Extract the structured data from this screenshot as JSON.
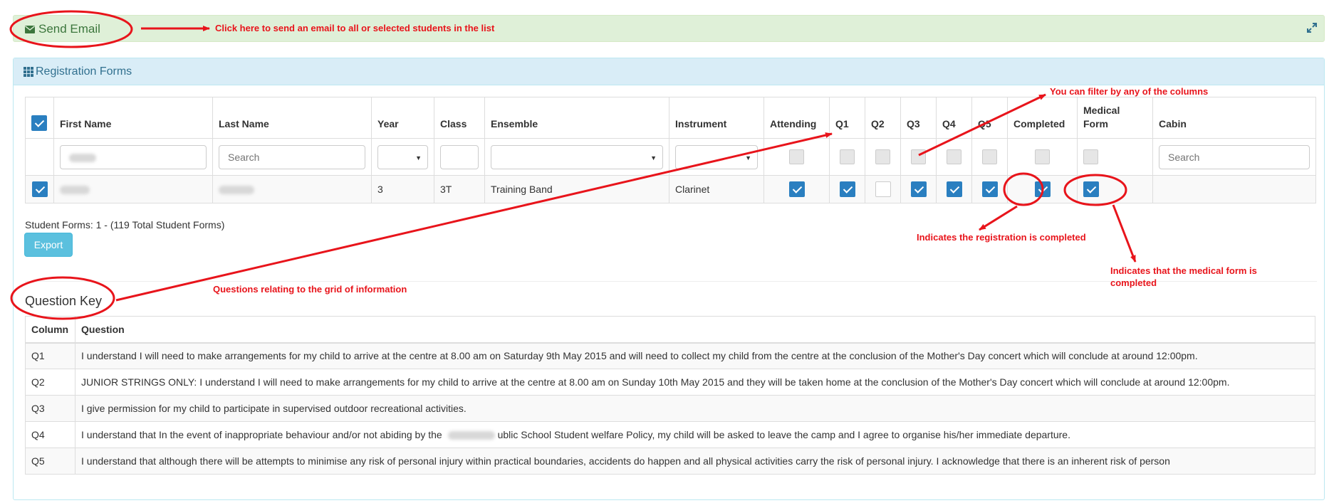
{
  "email_bar": {
    "send_email_label": "Send Email",
    "mail_icon": "envelope-icon",
    "expand_icon": "expand-icon"
  },
  "panel": {
    "title": "Registration Forms",
    "title_icon": "grid-icon"
  },
  "table": {
    "headers": [
      "First Name",
      "Last Name",
      "Year",
      "Class",
      "Ensemble",
      "Instrument",
      "Attending",
      "Q1",
      "Q2",
      "Q3",
      "Q4",
      "Q5",
      "Completed",
      "Medical Form",
      "Cabin"
    ],
    "filters": {
      "last_name_placeholder": "Search",
      "cabin_placeholder": "Search"
    },
    "rows": [
      {
        "selected": true,
        "year": "3",
        "class": "3T",
        "ensemble": "Training Band",
        "instrument": "Clarinet",
        "attending": true,
        "q1": true,
        "q2": false,
        "q3": true,
        "q4": true,
        "q5": true,
        "completed": true,
        "medical_form": true,
        "cabin": ""
      }
    ]
  },
  "footer": {
    "forms_count": "Student Forms: 1 - (119 Total Student Forms)",
    "export_label": "Export"
  },
  "question_key": {
    "title": "Question Key",
    "col_header": "Column",
    "question_header": "Question",
    "rows": [
      {
        "column": "Q1",
        "question": "I understand I will need to make arrangements for my child to arrive at the centre at 8.00 am on Saturday 9th May 2015 and will need to collect my child from the centre at the conclusion of the Mother's Day concert which will conclude at around 12:00pm."
      },
      {
        "column": "Q2",
        "question": "JUNIOR STRINGS ONLY: I understand I will need to make arrangements for my child to arrive at the centre at 8.00 am on Sunday 10th May 2015 and they will be taken home at the conclusion of the Mother's Day concert which will conclude at around 12:00pm."
      },
      {
        "column": "Q3",
        "question": "I give permission for my child to participate in supervised outdoor recreational activities."
      },
      {
        "column": "Q4",
        "question_before": "I understand that In the event of inappropriate behaviour and/or not abiding by the",
        "question_after": "ublic School Student welfare Policy, my child will be asked to leave the camp and I agree to organise his/her immediate departure."
      },
      {
        "column": "Q5",
        "question": "I understand that although there will be attempts to minimise any risk of personal injury within practical boundaries, accidents do happen and all physical activities carry the risk of personal injury. I acknowledge that there is an inherent risk of person"
      }
    ]
  },
  "annotations": {
    "send_email_note": "Click here to send an email to all or selected students in the list",
    "filter_note": "You can filter by any of the columns",
    "completed_note": "Indicates the registration is completed",
    "medical_note_line1": "Indicates that the medical form is",
    "medical_note_line2": "completed",
    "question_note": "Questions relating to the grid of information",
    "annotation_color": "#e8141b"
  }
}
